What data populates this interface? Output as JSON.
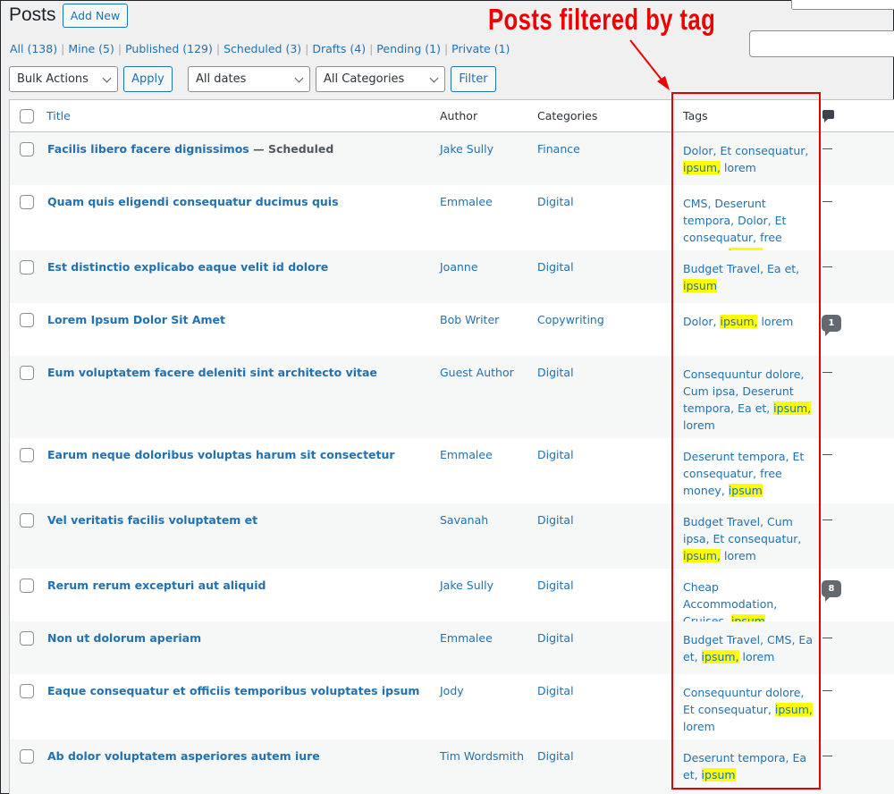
{
  "header": {
    "title": "Posts",
    "add_new": "Add New"
  },
  "annotation": {
    "text": "Posts filtered by tag",
    "color": "#ee0000"
  },
  "status_filters": [
    {
      "label": "All",
      "count": "(138)"
    },
    {
      "label": "Mine",
      "count": "(5)"
    },
    {
      "label": "Published",
      "count": "(129)"
    },
    {
      "label": "Scheduled",
      "count": "(3)"
    },
    {
      "label": "Drafts",
      "count": "(4)"
    },
    {
      "label": "Pending",
      "count": "(1)"
    },
    {
      "label": "Private",
      "count": "(1)"
    }
  ],
  "toolbar": {
    "bulk_actions": "Bulk Actions",
    "apply": "Apply",
    "dates": "All dates",
    "categories": "All Categories",
    "filter": "Filter",
    "search_value": ""
  },
  "columns": {
    "title": "Title",
    "author": "Author",
    "categories": "Categories",
    "tags": "Tags",
    "comments_icon": "comment-icon"
  },
  "highlight_tag": "ipsum",
  "rows": [
    {
      "title": "Facilis libero facere dignissimos",
      "state": " — Scheduled",
      "author": "Jake Sully",
      "category": "Finance",
      "tags_before": "Dolor, Et consequatur, ",
      "tag_hl": "ipsum,",
      "tags_after": " lorem",
      "comments": ""
    },
    {
      "title": "Quam quis eligendi consequatur ducimus quis",
      "state": "",
      "author": "Emmalee",
      "category": "Digital",
      "tags_before": "CMS, Deserunt tempora, Dolor, Et consequatur, free money, ",
      "tag_hl": "ipsum",
      "tags_after": "",
      "comments": ""
    },
    {
      "title": "Est distinctio explicabo eaque velit id dolore",
      "state": "",
      "author": "Joanne",
      "category": "Digital",
      "tags_before": "Budget Travel, Ea et, ",
      "tag_hl": "ipsum",
      "tags_after": "",
      "comments": ""
    },
    {
      "title": "Lorem Ipsum Dolor Sit Amet",
      "state": "",
      "author": "Bob Writer",
      "category": "Copywriting",
      "tags_before": "Dolor, ",
      "tag_hl": "ipsum,",
      "tags_after": " lorem",
      "comments": "1"
    },
    {
      "title": "Eum voluptatem facere deleniti sint architecto vitae",
      "state": "",
      "author": "Guest Author",
      "category": "Digital",
      "tags_before": "Consequuntur dolore, Cum ipsa, Deserunt tempora, Ea et, ",
      "tag_hl": "ipsum,",
      "tags_after": " lorem",
      "comments": ""
    },
    {
      "title": "Earum neque doloribus voluptas harum sit consectetur",
      "state": "",
      "author": "Emmalee",
      "category": "Digital",
      "tags_before": "Deserunt tempora, Et consequatur, free money, ",
      "tag_hl": "ipsum",
      "tags_after": "",
      "comments": ""
    },
    {
      "title": "Vel veritatis facilis voluptatem et",
      "state": "",
      "author": "Savanah",
      "category": "Digital",
      "tags_before": "Budget Travel, Cum ipsa, Et consequatur, ",
      "tag_hl": "ipsum,",
      "tags_after": " lorem",
      "comments": ""
    },
    {
      "title": "Rerum rerum excepturi aut aliquid",
      "state": "",
      "author": "Jake Sully",
      "category": "Digital",
      "tags_before": "Cheap Accommodation, Cruises, ",
      "tag_hl": "ipsum",
      "tags_after": "",
      "comments": "8"
    },
    {
      "title": "Non ut dolorum aperiam",
      "state": "",
      "author": "Emmalee",
      "category": "Digital",
      "tags_before": "Budget Travel, CMS, Ea et, ",
      "tag_hl": "ipsum,",
      "tags_after": " lorem",
      "comments": ""
    },
    {
      "title": "Eaque consequatur et officiis temporibus voluptates ipsum",
      "state": "",
      "author": "Jody",
      "category": "Digital",
      "tags_before": "Consequuntur dolore, Et consequatur, ",
      "tag_hl": "ipsum,",
      "tags_after": " lorem",
      "comments": ""
    },
    {
      "title": "Ab dolor voluptatem asperiores autem iure",
      "state": "",
      "author": "Tim Wordsmith",
      "category": "Digital",
      "tags_before": "Deserunt tempora, Ea et, ",
      "tag_hl": "ipsum",
      "tags_after": "",
      "comments": ""
    }
  ]
}
